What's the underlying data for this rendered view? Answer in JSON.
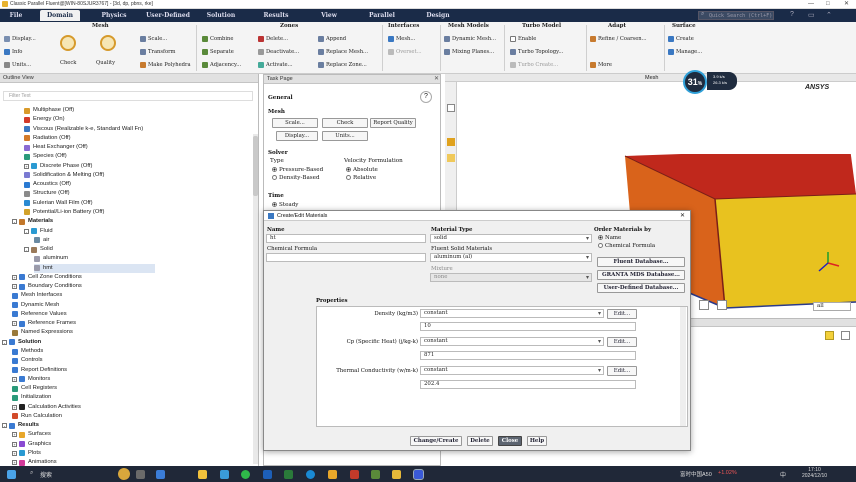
{
  "window": {
    "title": "Classic Parallel Fluent@[WIN-80SJUR3767] - [3d, dp, pbns, rke]",
    "min": "—",
    "max": "□",
    "close": "✕"
  },
  "tabs": [
    "File",
    "Domain",
    "Physics",
    "User-Defined",
    "Solution",
    "Results",
    "View",
    "Parallel",
    "Design"
  ],
  "search": {
    "placeholder": "Quick Search (Ctrl+F)"
  },
  "ribbon": {
    "groups": [
      "Mesh",
      "Zones",
      "Interfaces",
      "Mesh Models",
      "Turbo Model",
      "Adapt",
      "Surface"
    ],
    "mesh": {
      "display": "Display...",
      "info": "Info",
      "units": "Units...",
      "check": "Check",
      "quality": "Quality",
      "scale": "Scale...",
      "transform": "Transform",
      "polyhedra": "Make Polyhedra"
    },
    "zones": {
      "combine": "Combine",
      "separate": "Separate",
      "adjacency": "Adjacency...",
      "delete": "Delete...",
      "deactivate": "Deactivate...",
      "activate": "Activate...",
      "append": "Append",
      "replace_mesh": "Replace Mesh...",
      "replace_zone": "Replace Zone..."
    },
    "interfaces": {
      "mesh": "Mesh...",
      "overset": "Overset..."
    },
    "mesh_models": {
      "dynamic": "Dynamic Mesh...",
      "mixing": "Mixing Planes..."
    },
    "turbo": {
      "enable": "Enable",
      "topology": "Turbo Topology...",
      "create": "Turbo Create..."
    },
    "adapt": {
      "refine": "Refine / Coarsen...",
      "more": "More"
    },
    "surface": {
      "create": "Create",
      "manage": "Manage..."
    }
  },
  "outline": {
    "title": "Outline View",
    "filter_placeholder": "Filter Text",
    "items": [
      "Multiphase (Off)",
      "Energy (On)",
      "Viscous (Realizable k-e, Standard Wall Fn)",
      "Radiation (Off)",
      "Heat Exchanger (Off)",
      "Species (Off)",
      "Discrete Phase (Off)",
      "Solidification & Melting (Off)",
      "Acoustics (Off)",
      "Structure (Off)",
      "Eulerian Wall Film (Off)",
      "Potential/Li-ion Battery (Off)",
      "Materials",
      "Fluid",
      "air",
      "Solid",
      "aluminum",
      "hmt",
      "Cell Zone Conditions",
      "Boundary Conditions",
      "Mesh Interfaces",
      "Dynamic Mesh",
      "Reference Values",
      "Reference Frames",
      "Named Expressions",
      "Solution",
      "Methods",
      "Controls",
      "Report Definitions",
      "Monitors",
      "Cell Registers",
      "Initialization",
      "Calculation Activities",
      "Run Calculation",
      "Results",
      "Surfaces",
      "Graphics",
      "Plots",
      "Animations"
    ]
  },
  "task_page": {
    "title": "Task Page",
    "section": "General",
    "mesh_label": "Mesh",
    "buttons": {
      "scale": "Scale...",
      "check": "Check",
      "report_quality": "Report Quality",
      "display": "Display...",
      "units": "Units..."
    },
    "solver": "Solver",
    "type": "Type",
    "pressure_based": "Pressure-Based",
    "density_based": "Density-Based",
    "velocity_formulation": "Velocity Formulation",
    "absolute": "Absolute",
    "relative": "Relative",
    "time": "Time",
    "steady": "Steady"
  },
  "viewport": {
    "title": "Mesh",
    "cpu_percent": "31",
    "cpu_suffix": "%",
    "net_up": "3.9 k/s",
    "net_down": "26.3 k/s",
    "brand": "ANSYS",
    "view_select": "all"
  },
  "dialog": {
    "title": "Create/Edit Materials",
    "name_label": "Name",
    "name_value": "ht",
    "chem_label": "Chemical Formula",
    "chem_value": "",
    "material_type_label": "Material Type",
    "material_type": "solid",
    "fluent_solid_label": "Fluent Solid Materials",
    "fluent_solid": "aluminum (al)",
    "mixture_label": "Mixture",
    "mixture": "none",
    "order_label": "Order Materials by",
    "order_name": "Name",
    "order_chem": "Chemical Formula",
    "btn_fluent_db": "Fluent Database...",
    "btn_granta": "GRANTA MDS Database...",
    "btn_user_db": "User-Defined Database...",
    "properties_label": "Properties",
    "props": [
      {
        "label": "Density (kg/m3)",
        "method": "constant",
        "value": "10",
        "edit": "Edit..."
      },
      {
        "label": "Cp (Specific Heat) (j/kg-k)",
        "method": "constant",
        "value": "871",
        "edit": "Edit..."
      },
      {
        "label": "Thermal Conductivity (w/m-k)",
        "method": "constant",
        "value": "202.4",
        "edit": "Edit..."
      }
    ],
    "btn_change": "Change/Create",
    "btn_delete": "Delete",
    "btn_close": "Close",
    "btn_help": "Help"
  },
  "taskbar": {
    "search": "搜索",
    "stock": "富时中国A50",
    "stock_change": "+1.02%",
    "time": "17:10",
    "date": "2024/12/10",
    "lang": "中"
  },
  "colors": {
    "ribbon_dark": "#1a2b48",
    "box_red": "#c0281c",
    "box_orange": "#d9631b",
    "box_yellow": "#e8c21f"
  }
}
